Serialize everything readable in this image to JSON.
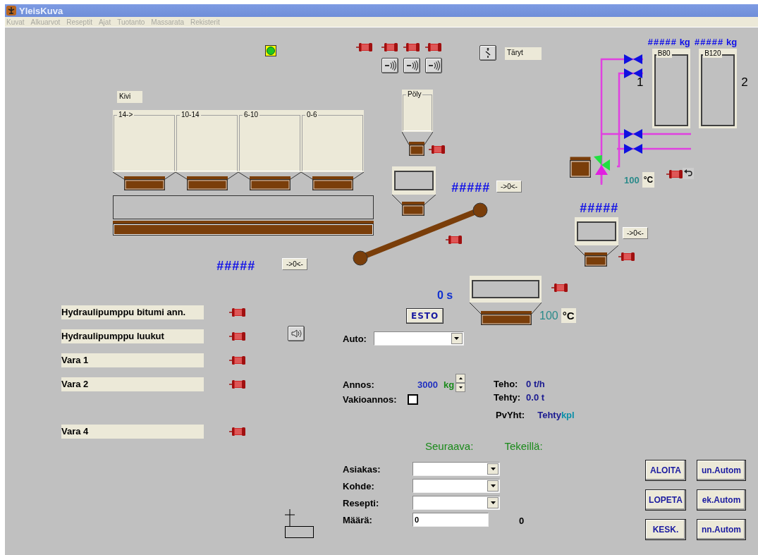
{
  "window": {
    "title": "YleisKuva"
  },
  "menu": [
    "Kuvat",
    "Alkuarvot",
    "Reseptit",
    "Ajat",
    "Tuotanto",
    "Massarata",
    "Rekisterit"
  ],
  "status_light": {
    "on": true
  },
  "vibrator_label": "Täryt",
  "stone_label": "Kivi",
  "bins": [
    {
      "label": "14->"
    },
    {
      "label": "10-14"
    },
    {
      "label": "6-10"
    },
    {
      "label": "0-6"
    }
  ],
  "dust_silo": {
    "label": "Pöly"
  },
  "bitumen_tanks": [
    {
      "label": "B80",
      "weight": "#####",
      "unit": "kg",
      "number": "1"
    },
    {
      "label": "B120",
      "weight": "#####",
      "unit": "kg",
      "number": "2"
    }
  ],
  "bitumen_temp": {
    "value": "100",
    "unit": "°C"
  },
  "scales": [
    {
      "value": "#####",
      "button": "->0<-"
    },
    {
      "value": "#####",
      "button": "->0<-"
    },
    {
      "value": "#####",
      "button": "->0<-"
    }
  ],
  "mixer": {
    "timer": "0 s",
    "block_button": "ESTO",
    "temp": "100",
    "unit": "°C"
  },
  "pumps": [
    {
      "label": "Hydraulipumppu bitumi ann."
    },
    {
      "label": "Hydraulipumppu luukut"
    },
    {
      "label": "Vara 1"
    },
    {
      "label": "Vara 2"
    }
  ],
  "spare_pumps": [
    {
      "label": "Vara 4"
    }
  ],
  "auto": {
    "label": "Auto:"
  },
  "batch": {
    "label": "Annos:",
    "value": "3000",
    "unit": "kg"
  },
  "fixed_batch": {
    "label": "Vakioannos:",
    "checked": false
  },
  "stats": [
    {
      "label": "Teho:",
      "value": "0 t/h"
    },
    {
      "label": "Tehty:",
      "value": "0.0 t"
    }
  ],
  "daily_total": {
    "label": "PvYht:",
    "value": "Tehty",
    "unit": "kpl"
  },
  "headings": [
    "Seuraava:",
    "Tekeillä:"
  ],
  "order_fields": [
    {
      "label": "Asiakas:",
      "kind": "dropdown"
    },
    {
      "label": "Kohde:",
      "kind": "dropdown"
    },
    {
      "label": "Resepti:",
      "kind": "dropdown"
    },
    {
      "label": "Määrä:",
      "kind": "text",
      "value": "0"
    }
  ],
  "amount_in_progress": "0",
  "control_buttons": [
    "ALOITA",
    "LOPETA",
    "KESK."
  ],
  "auto_buttons": [
    "un.Autom",
    "ek.Autom",
    "nn.Autom"
  ]
}
